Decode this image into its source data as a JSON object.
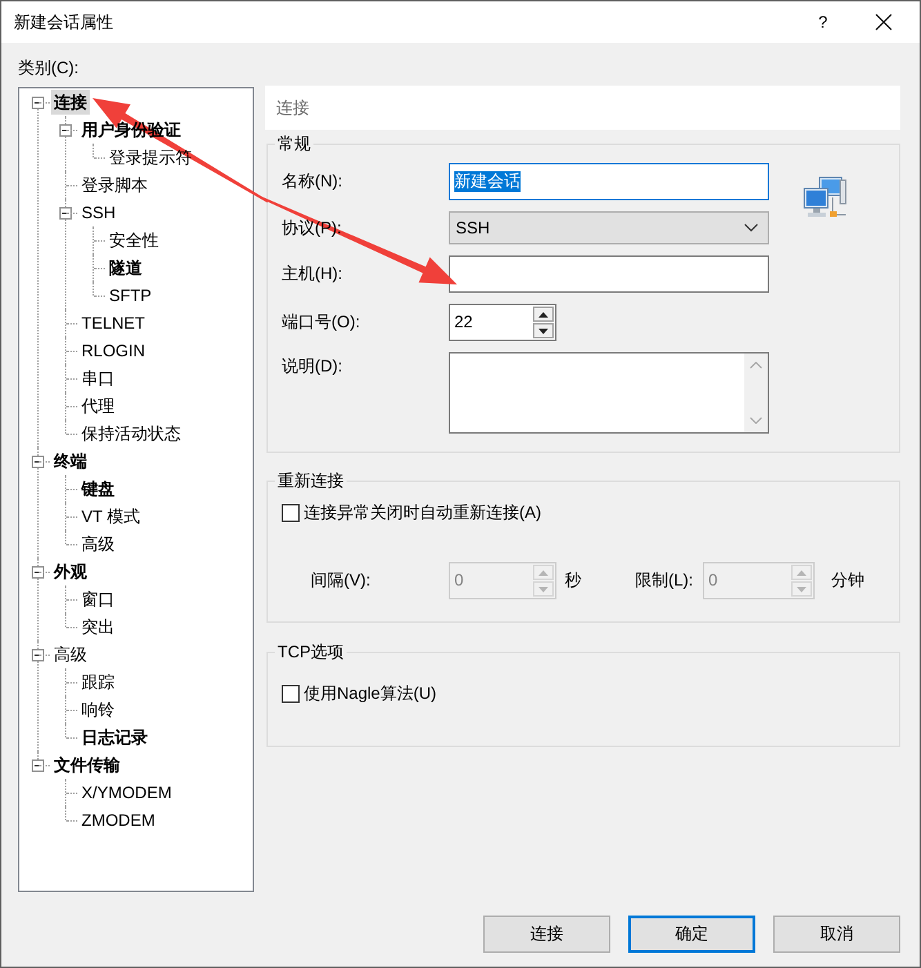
{
  "window": {
    "title": "新建会话属性",
    "help_button": "?"
  },
  "category_label": "类别(C):",
  "tree": [
    {
      "label": "连接",
      "bold": true,
      "selected": true,
      "expanded": true,
      "children": [
        {
          "label": "用户身份验证",
          "bold": true,
          "selected": false,
          "expanded": true,
          "children": [
            {
              "label": "登录提示符",
              "bold": false,
              "selected": false
            }
          ]
        },
        {
          "label": "登录脚本",
          "bold": false,
          "selected": false
        },
        {
          "label": "SSH",
          "bold": false,
          "selected": false,
          "expanded": true,
          "children": [
            {
              "label": "安全性",
              "bold": false,
              "selected": false
            },
            {
              "label": "隧道",
              "bold": true,
              "selected": false
            },
            {
              "label": "SFTP",
              "bold": false,
              "selected": false
            }
          ]
        },
        {
          "label": "TELNET",
          "bold": false,
          "selected": false
        },
        {
          "label": "RLOGIN",
          "bold": false,
          "selected": false
        },
        {
          "label": "串口",
          "bold": false,
          "selected": false
        },
        {
          "label": "代理",
          "bold": false,
          "selected": false
        },
        {
          "label": "保持活动状态",
          "bold": false,
          "selected": false
        }
      ]
    },
    {
      "label": "终端",
      "bold": true,
      "selected": false,
      "expanded": true,
      "children": [
        {
          "label": "键盘",
          "bold": true,
          "selected": false
        },
        {
          "label": "VT 模式",
          "bold": false,
          "selected": false
        },
        {
          "label": "高级",
          "bold": false,
          "selected": false
        }
      ]
    },
    {
      "label": "外观",
      "bold": true,
      "selected": false,
      "expanded": true,
      "children": [
        {
          "label": "窗口",
          "bold": false,
          "selected": false
        },
        {
          "label": "突出",
          "bold": false,
          "selected": false
        }
      ]
    },
    {
      "label": "高级",
      "bold": false,
      "selected": false,
      "expanded": true,
      "children": [
        {
          "label": "跟踪",
          "bold": false,
          "selected": false
        },
        {
          "label": "响铃",
          "bold": false,
          "selected": false
        },
        {
          "label": "日志记录",
          "bold": true,
          "selected": false
        }
      ]
    },
    {
      "label": "文件传输",
      "bold": true,
      "selected": false,
      "expanded": true,
      "children": [
        {
          "label": "X/YMODEM",
          "bold": false,
          "selected": false
        },
        {
          "label": "ZMODEM",
          "bold": false,
          "selected": false
        }
      ]
    }
  ],
  "page_title": "连接",
  "general": {
    "title": "常规",
    "fields": [
      {
        "kind": "text",
        "label": "名称(N):",
        "value": "新建会话",
        "focused": true
      },
      {
        "kind": "select",
        "label": "协议(P):",
        "value": "SSH"
      },
      {
        "kind": "text",
        "label": "主机(H):",
        "focused": false
      },
      {
        "kind": "spin",
        "label": "端口号(O):",
        "value": "22"
      },
      {
        "kind": "textarea",
        "label": "说明(D):"
      }
    ]
  },
  "reconnect": {
    "title": "重新连接",
    "checkbox": {
      "label": "连接异常关闭时自动重新连接(A)",
      "checked": false
    },
    "interval": {
      "label": "间隔(V):",
      "value": "0",
      "unit": "秒",
      "disabled": true
    },
    "limit": {
      "label": "限制(L):",
      "value": "0",
      "unit": "分钟",
      "disabled": true
    }
  },
  "tcp": {
    "title": "TCP选项",
    "checkbox": {
      "label": "使用Nagle算法(U)",
      "checked": false
    }
  },
  "buttons": [
    {
      "label": "连接",
      "default": false
    },
    {
      "label": "确定",
      "default": true
    },
    {
      "label": "取消",
      "default": false
    }
  ]
}
